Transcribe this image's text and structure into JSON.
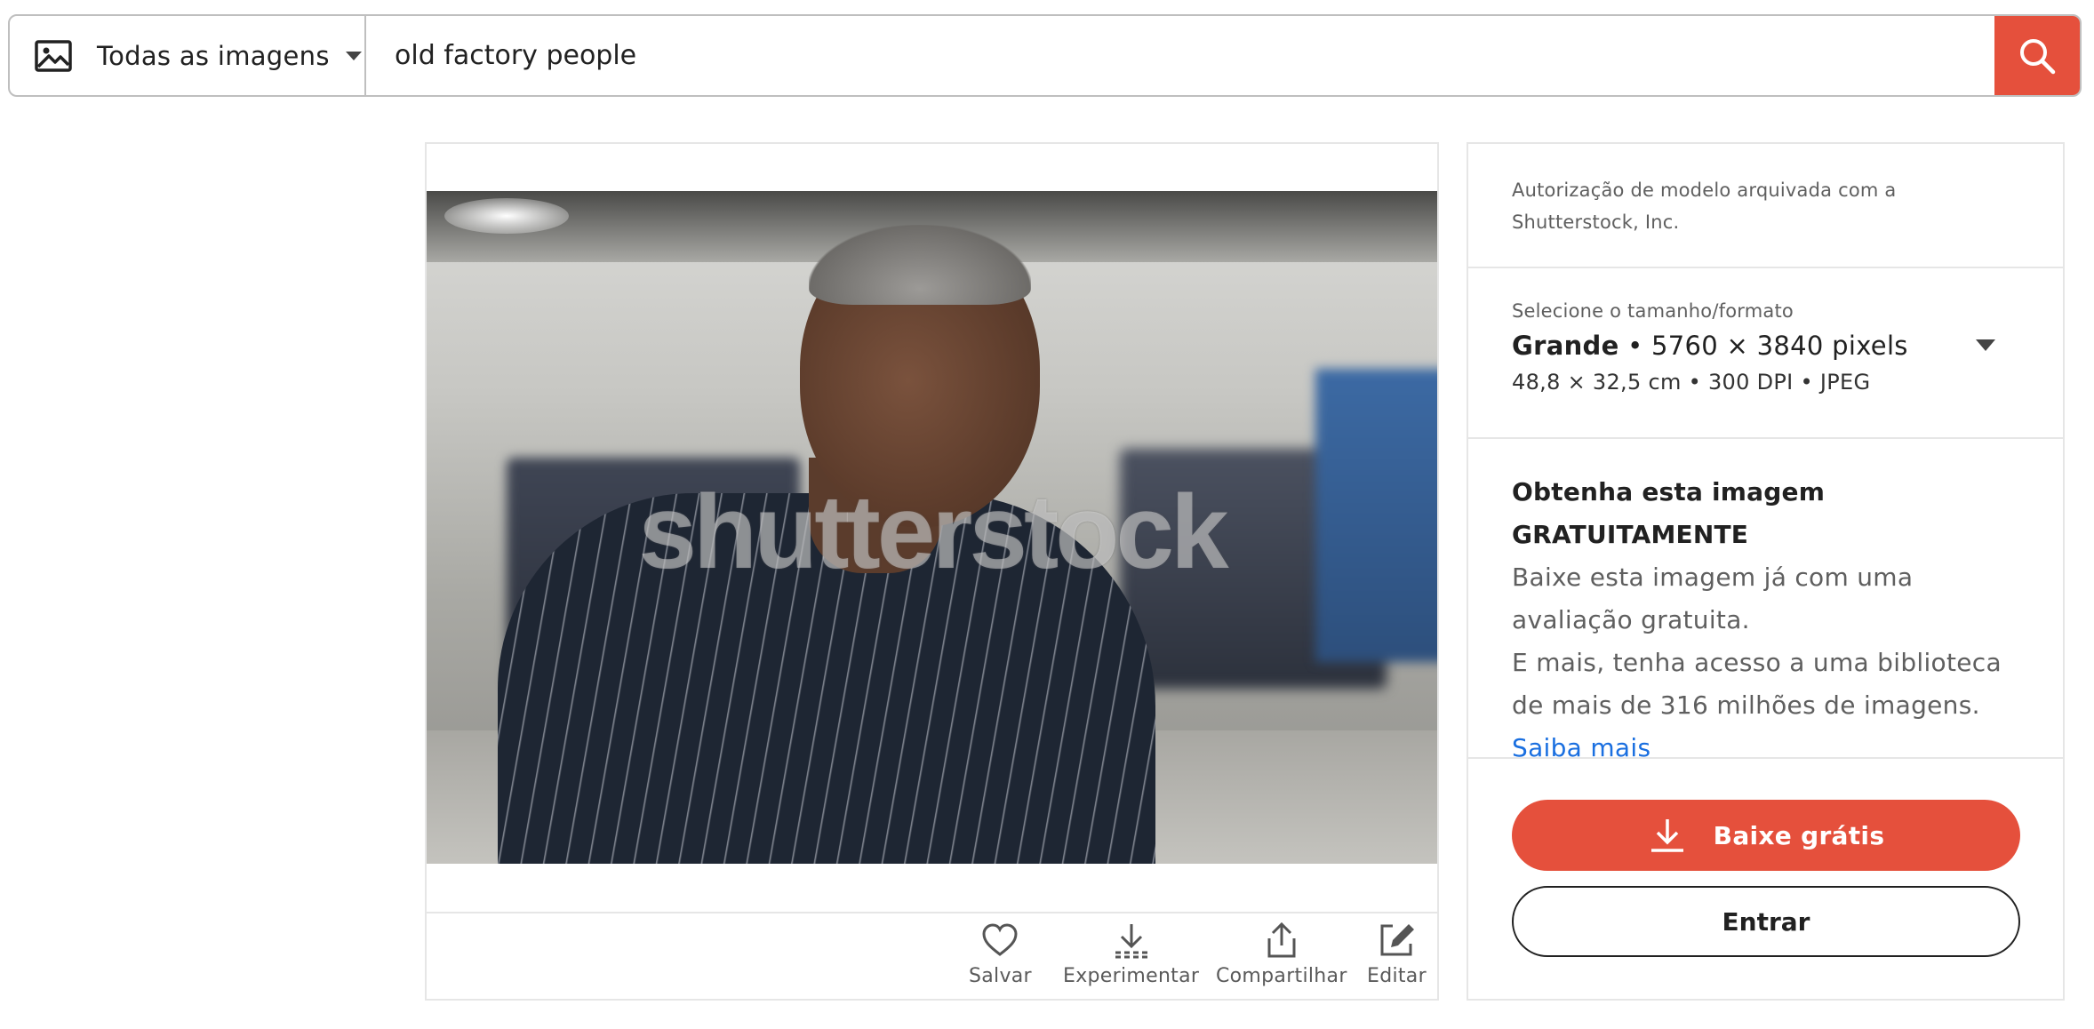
{
  "search": {
    "type_label": "Todas as imagens",
    "query": "old factory people"
  },
  "image": {
    "watermark": "shutterstock",
    "actions": [
      {
        "label": "Salvar",
        "icon": "heart-icon"
      },
      {
        "label": "Experimentar",
        "icon": "download-dashed-icon"
      },
      {
        "label": "Compartilhar",
        "icon": "share-icon"
      },
      {
        "label": "Editar",
        "icon": "edit-icon"
      }
    ]
  },
  "sidebar": {
    "release_text": "Autorização de modelo arquivada com a Shutterstock, Inc.",
    "size": {
      "label": "Selecione o tamanho/formato",
      "name": "Grande",
      "pixels": "• 5760 × 3840 pixels",
      "specs": "48,8 × 32,5 cm • 300 DPI • JPEG"
    },
    "free": {
      "title": "Obtenha esta imagem GRATUITAMENTE",
      "line1": "Baixe esta imagem já com uma avaliação gratuita.",
      "line2": "E mais, tenha acesso a uma biblioteca de mais de 316 milhões de imagens.",
      "link": "Saiba mais"
    },
    "download_button": "Baixe grátis",
    "login_button": "Entrar"
  },
  "colors": {
    "accent": "#e5503c",
    "link": "#1a6fe0"
  }
}
